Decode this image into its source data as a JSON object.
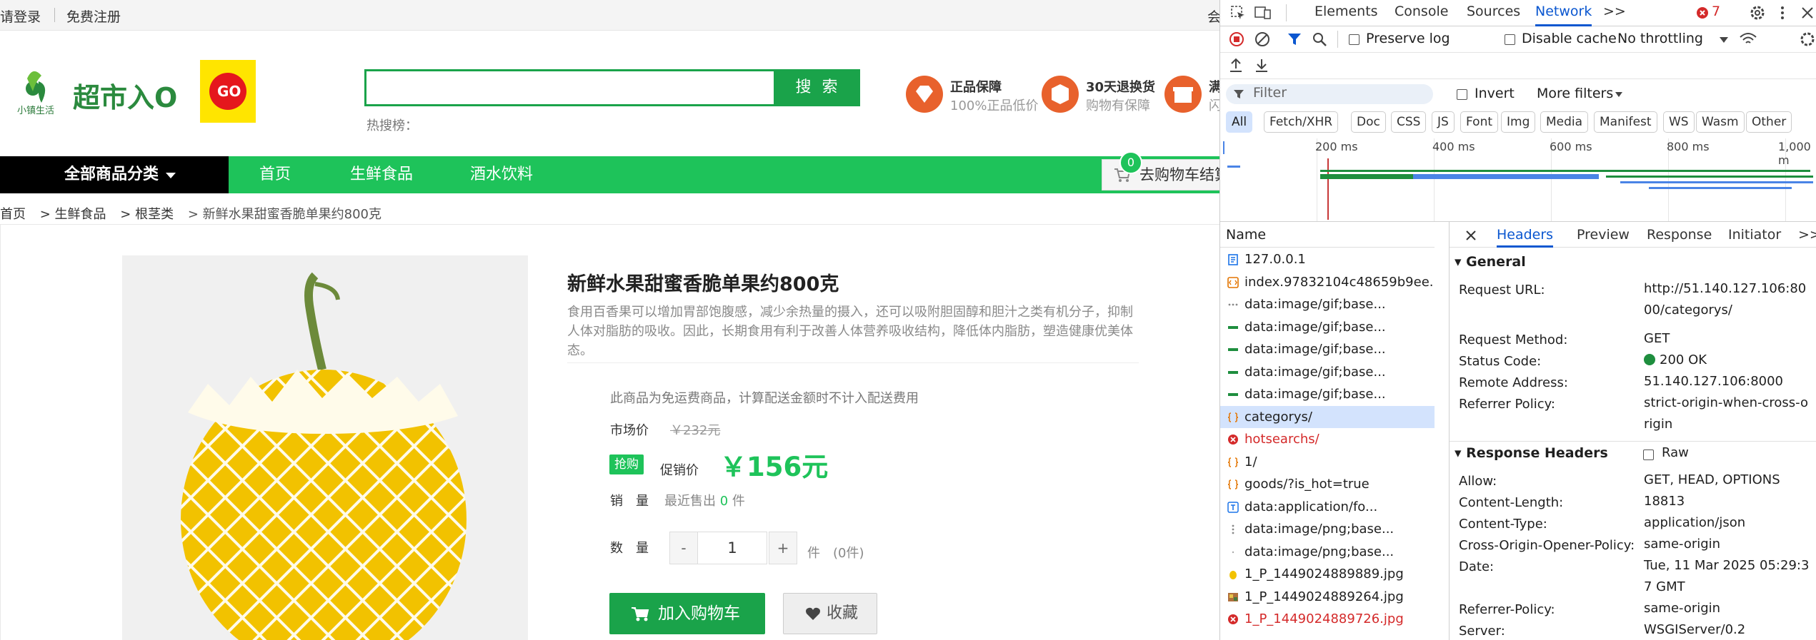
{
  "shop": {
    "topbar": {
      "login": "请登录",
      "register": "免费注册",
      "right_partial": "会"
    },
    "logo": {
      "text": "超市入O",
      "small_text": "小镇生活",
      "badge_text": "GO"
    },
    "search": {
      "value": "",
      "button": "搜 索",
      "hot_label": "热搜榜："
    },
    "features": [
      {
        "title": "正品保障",
        "sub": "100%正品低价"
      },
      {
        "title": "30天退换货",
        "sub": "购物有保障"
      },
      {
        "title": "满",
        "sub": "闪"
      }
    ],
    "nav": {
      "all_categories": "全部商品分类",
      "items": [
        "首页",
        "生鲜食品",
        "酒水饮料"
      ],
      "cart_label": "去购物车结算",
      "cart_count": "0"
    },
    "breadcrumb": [
      "首页",
      "> 生鲜食品",
      "> 根茎类",
      "> 新鲜水果甜蜜香脆单果约800克"
    ],
    "product": {
      "title": "新鲜水果甜蜜香脆单果约800克",
      "description": "食用百香果可以增加胃部饱腹感，减少余热量的摄入，还可以吸附胆固醇和胆汁之类有机分子，抑制人体对脂肪的吸收。因此，长期食用有利于改善人体营养吸收结构，降低体内脂肪，塑造健康优美体态。",
      "shipping_note": "此商品为免运费商品，计算配送金额时不计入配送费用",
      "market_label": "市场价",
      "market_price": "￥232元",
      "promo_tag": "抢购",
      "promo_label": "促销价",
      "promo_price": "￥156元",
      "sales_label": "销　量",
      "sales_prefix": "最近售出",
      "sales_count": "0",
      "sales_unit": "件",
      "qty_label": "数　量",
      "qty_minus": "-",
      "qty_value": "1",
      "qty_plus": "+",
      "qty_unit": "件　(0件)",
      "add_to_cart": "加入购物车",
      "favorite": "收藏"
    }
  },
  "devtools": {
    "tabs": [
      "Elements",
      "Console",
      "Sources",
      "Network"
    ],
    "more_tabs": ">>",
    "error_count": "7",
    "toolbar": {
      "preserve_log": "Preserve log",
      "disable_cache": "Disable cache",
      "throttling": "No throttling"
    },
    "filter": {
      "placeholder": "Filter",
      "invert": "Invert",
      "more_filters": "More filters"
    },
    "types": [
      "All",
      "Fetch/XHR",
      "Doc",
      "CSS",
      "JS",
      "Font",
      "Img",
      "Media",
      "Manifest",
      "WS",
      "Wasm",
      "Other"
    ],
    "timeline_labels": [
      "200 ms",
      "400 ms",
      "600 ms",
      "800 ms",
      "1,000 m"
    ],
    "name_header": "Name",
    "requests": [
      {
        "name": "127.0.0.1",
        "icon": "doc",
        "status": "ok"
      },
      {
        "name": "index.97832104c48659b9ee...",
        "icon": "script",
        "status": "ok"
      },
      {
        "name": "data:image/gif;base...",
        "icon": "dots",
        "status": "ok"
      },
      {
        "name": "data:image/gif;base...",
        "icon": "green-bar",
        "status": "ok"
      },
      {
        "name": "data:image/gif;base...",
        "icon": "green-bar",
        "status": "ok"
      },
      {
        "name": "data:image/gif;base...",
        "icon": "green-bar",
        "status": "ok"
      },
      {
        "name": "data:image/gif;base...",
        "icon": "green-bar",
        "status": "ok"
      },
      {
        "name": "categorys/",
        "icon": "json",
        "status": "selected"
      },
      {
        "name": "hotsearchs/",
        "icon": "error",
        "status": "error"
      },
      {
        "name": "1/",
        "icon": "json",
        "status": "ok"
      },
      {
        "name": "goods/?is_hot=true",
        "icon": "json",
        "status": "ok"
      },
      {
        "name": "data:application/fo...",
        "icon": "font",
        "status": "ok"
      },
      {
        "name": "data:image/png;base...",
        "icon": "dots-v",
        "status": "ok"
      },
      {
        "name": "data:image/png;base...",
        "icon": "dot",
        "status": "ok"
      },
      {
        "name": "1_P_1449024889889.jpg",
        "icon": "img-yellow",
        "status": "ok"
      },
      {
        "name": "1_P_1449024889264.jpg",
        "icon": "img-color",
        "status": "ok"
      },
      {
        "name": "1_P_1449024889726.jpg",
        "icon": "error",
        "status": "error"
      }
    ],
    "detail_tabs": [
      "Headers",
      "Preview",
      "Response",
      "Initiator"
    ],
    "general": {
      "title": "General",
      "rows": [
        {
          "k": "Request URL:",
          "v": "http://51.140.127.106:8000/categorys/"
        },
        {
          "k": "Request Method:",
          "v": "GET"
        },
        {
          "k": "Status Code:",
          "v": "200 OK"
        },
        {
          "k": "Remote Address:",
          "v": "51.140.127.106:8000"
        },
        {
          "k": "Referrer Policy:",
          "v": "strict-origin-when-cross-origin"
        }
      ]
    },
    "response_headers": {
      "title": "Response Headers",
      "raw": "Raw",
      "rows": [
        {
          "k": "Allow:",
          "v": "GET, HEAD, OPTIONS"
        },
        {
          "k": "Content-Length:",
          "v": "18813"
        },
        {
          "k": "Content-Type:",
          "v": "application/json"
        },
        {
          "k": "Cross-Origin-Opener-Policy:",
          "v": "same-origin"
        },
        {
          "k": "Date:",
          "v": "Tue, 11 Mar 2025 05:29:37 GMT"
        },
        {
          "k": "Referrer-Policy:",
          "v": "same-origin"
        },
        {
          "k": "Server:",
          "v": "WSGIServer/0.2"
        }
      ]
    },
    "colors": {
      "accent": "#0b57d0",
      "error": "#d42a2a",
      "ok": "#1e8e3e",
      "shop_green": "#1ec35a"
    }
  }
}
